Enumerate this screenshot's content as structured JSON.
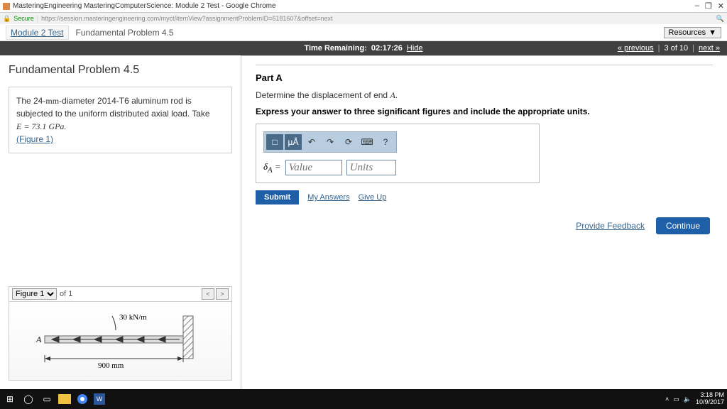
{
  "chrome": {
    "tab_title": "MasteringEngineering MasteringComputerScience: Module 2 Test - Google Chrome",
    "secure": "Secure",
    "url": "https://session.masteringengineering.com/myct/itemView?assignmentProblemID=6181607&offset=next",
    "win_min": "–",
    "win_max": "❐",
    "win_close": "✕"
  },
  "breadcrumb": {
    "item1": "Module 2 Test",
    "item2": "Fundamental Problem 4.5",
    "resources": "Resources"
  },
  "timebar": {
    "label": "Time Remaining:",
    "time": "02:17:26",
    "hide": "Hide",
    "prev": "« previous",
    "count": "3 of 10",
    "next": "next »"
  },
  "left": {
    "title": "Fundamental Problem 4.5",
    "body_pre": "The 24-",
    "body_mm": "mm",
    "body_mid": "-diameter 2014-T6 aluminum rod is subjected to the uniform distributed axial load. Take",
    "body_E": "E = 73.1 GPa.",
    "fig_link": "(Figure 1)",
    "figure_sel": "Figure 1",
    "figure_of": "of 1",
    "figure_prev": "<",
    "figure_next": ">",
    "figure_load": "30 kN/m",
    "figure_len": "900 mm",
    "figure_A": "A"
  },
  "right": {
    "part_title": "Part A",
    "question_pre": "Determine the displacement of end ",
    "question_var": "A",
    "question_post": ".",
    "instruction": "Express your answer to three significant figures and include the appropriate units.",
    "tb_frac": "□",
    "tb_ua": "µÅ",
    "tb_undo": "↶",
    "tb_redo": "↷",
    "tb_reset": "⟳",
    "tb_kbd": "⌨",
    "tb_help": "?",
    "sym": "δA =",
    "value_ph": "Value",
    "units_ph": "Units",
    "submit": "Submit",
    "my_answers": "My Answers",
    "give_up": "Give Up",
    "feedback": "Provide Feedback",
    "continue": "Continue"
  },
  "taskbar": {
    "time": "3:18 PM",
    "date": "10/9/2017"
  }
}
